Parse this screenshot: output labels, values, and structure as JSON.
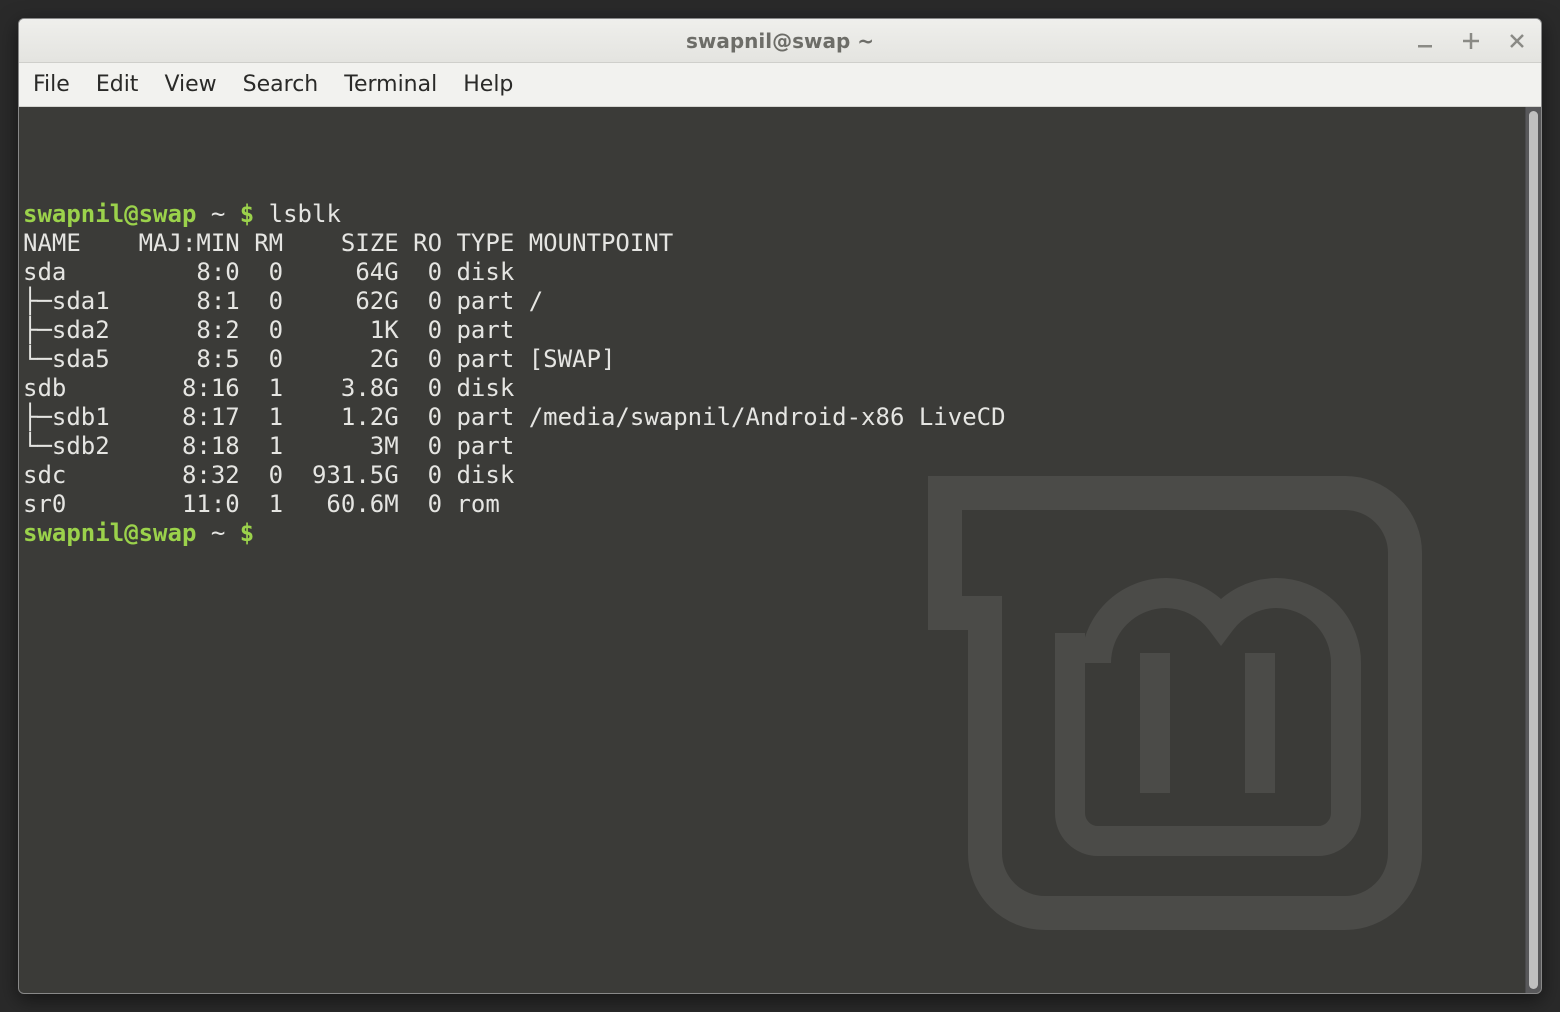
{
  "window": {
    "title": "swapnil@swap ~"
  },
  "menu": {
    "file": "File",
    "edit": "Edit",
    "view": "View",
    "search": "Search",
    "terminal": "Terminal",
    "help": "Help"
  },
  "prompt": {
    "userhost": "swapnil@swap",
    "path": "~",
    "symbol": "$"
  },
  "command": "lsblk",
  "headers": {
    "name": "NAME",
    "majmin": "MAJ:MIN",
    "rm": "RM",
    "size": "SIZE",
    "ro": "RO",
    "type": "TYPE",
    "mountpoint": "MOUNTPOINT"
  },
  "rows": [
    {
      "name": "sda",
      "tree": "",
      "majmin": "8:0",
      "rm": "0",
      "size": "64G",
      "ro": "0",
      "type": "disk",
      "mount": ""
    },
    {
      "name": "sda1",
      "tree": "├─",
      "majmin": "8:1",
      "rm": "0",
      "size": "62G",
      "ro": "0",
      "type": "part",
      "mount": "/"
    },
    {
      "name": "sda2",
      "tree": "├─",
      "majmin": "8:2",
      "rm": "0",
      "size": "1K",
      "ro": "0",
      "type": "part",
      "mount": ""
    },
    {
      "name": "sda5",
      "tree": "└─",
      "majmin": "8:5",
      "rm": "0",
      "size": "2G",
      "ro": "0",
      "type": "part",
      "mount": "[SWAP]"
    },
    {
      "name": "sdb",
      "tree": "",
      "majmin": "8:16",
      "rm": "1",
      "size": "3.8G",
      "ro": "0",
      "type": "disk",
      "mount": ""
    },
    {
      "name": "sdb1",
      "tree": "├─",
      "majmin": "8:17",
      "rm": "1",
      "size": "1.2G",
      "ro": "0",
      "type": "part",
      "mount": "/media/swapnil/Android-x86 LiveCD"
    },
    {
      "name": "sdb2",
      "tree": "└─",
      "majmin": "8:18",
      "rm": "1",
      "size": "3M",
      "ro": "0",
      "type": "part",
      "mount": ""
    },
    {
      "name": "sdc",
      "tree": "",
      "majmin": "8:32",
      "rm": "0",
      "size": "931.5G",
      "ro": "0",
      "type": "disk",
      "mount": ""
    },
    {
      "name": "sr0",
      "tree": "",
      "majmin": "11:0",
      "rm": "1",
      "size": "60.6M",
      "ro": "0",
      "type": "rom",
      "mount": ""
    }
  ],
  "colwidths": {
    "name": 7,
    "majmin": 8,
    "rm": 3,
    "size": 7,
    "ro": 3,
    "type": 5
  }
}
